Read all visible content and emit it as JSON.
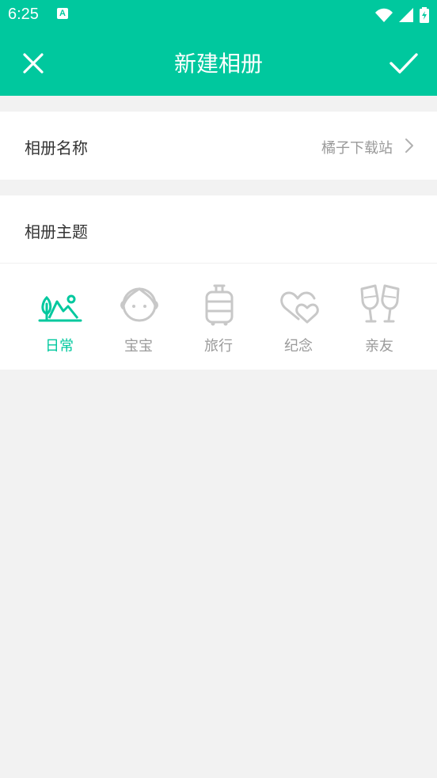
{
  "status_bar": {
    "time": "6:25",
    "notification_icon": "a-letter-icon",
    "wifi_icon": "wifi-icon",
    "signal_icon": "signal-icon",
    "battery_icon": "battery-charging-icon",
    "a_label": "A"
  },
  "toolbar": {
    "title": "新建相册",
    "close_icon": "close-icon",
    "confirm_icon": "check-icon"
  },
  "album_name": {
    "label": "相册名称",
    "value": "橘子下载站",
    "chevron_icon": "chevron-right-icon"
  },
  "theme": {
    "label": "相册主题",
    "items": [
      {
        "label": "日常",
        "icon": "mountain-icon",
        "selected": true
      },
      {
        "label": "宝宝",
        "icon": "baby-face-icon",
        "selected": false
      },
      {
        "label": "旅行",
        "icon": "suitcase-icon",
        "selected": false
      },
      {
        "label": "纪念",
        "icon": "hearts-icon",
        "selected": false
      },
      {
        "label": "亲友",
        "icon": "glasses-toast-icon",
        "selected": false
      }
    ]
  },
  "colors": {
    "accent": "#00c89e",
    "inactive": "#c8c8c8",
    "background": "#f2f2f2"
  }
}
